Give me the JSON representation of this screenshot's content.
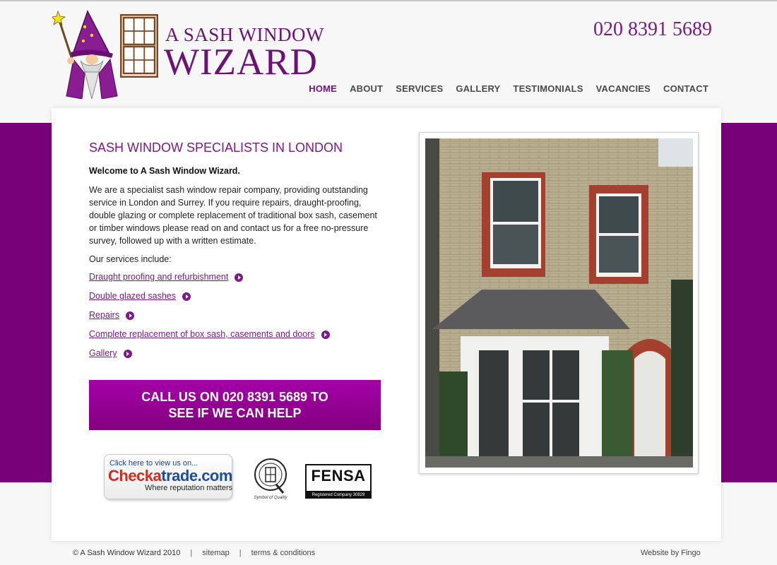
{
  "brand": {
    "logo_line1": "A SASH WINDOW",
    "logo_line2": "WIZARD",
    "phone": "020 8391 5689",
    "accent_color": "#7a1a83",
    "band_color": "#780078"
  },
  "nav": {
    "items": [
      {
        "label": "HOME",
        "active": true
      },
      {
        "label": "ABOUT"
      },
      {
        "label": "SERVICES"
      },
      {
        "label": "GALLERY"
      },
      {
        "label": "TESTIMONIALS"
      },
      {
        "label": "VACANCIES"
      },
      {
        "label": "CONTACT"
      }
    ]
  },
  "main": {
    "heading": "SASH WINDOW SPECIALISTS IN LONDON",
    "welcome": "Welcome to A Sash Window Wizard.",
    "intro": "We are a specialist sash window repair company, providing outstanding service in London and Surrey. If you require repairs, draught-proofing, double glazing or complete replacement of traditional box sash, casement or timber windows please read on and contact us for a free no-pressure survey, followed up with a written estimate.",
    "services_intro": "Our services include:",
    "services": [
      {
        "label": "Draught proofing and refurbishment",
        "icon": "play-circle-icon"
      },
      {
        "label": "Double glazed sashes",
        "icon": "play-circle-icon"
      },
      {
        "label": "Repairs",
        "icon": "play-circle-icon"
      },
      {
        "label": "Complete replacement of box sash, casements and doors",
        "icon": "play-circle-icon"
      },
      {
        "label": "Gallery",
        "icon": "play-circle-icon"
      }
    ],
    "cta_line1": "CALL US ON 020 8391 5689 TO",
    "cta_line2": "SEE IF WE CAN HELP"
  },
  "badges": {
    "checkatrade_top": "Click here to view us on...",
    "checkatrade_brand_red": "Checka",
    "checkatrade_brand_blue": "trade.com",
    "checkatrade_tag": "Where reputation matters",
    "quality_caption": "Symbol of Quality",
    "fensa_word": "FENSA",
    "fensa_reg": "Registered Company 30829"
  },
  "footer": {
    "copyright": "© A Sash Window Wizard 2010",
    "sitemap": "sitemap",
    "terms": "terms & conditions",
    "credit": "Website by Fingo"
  }
}
